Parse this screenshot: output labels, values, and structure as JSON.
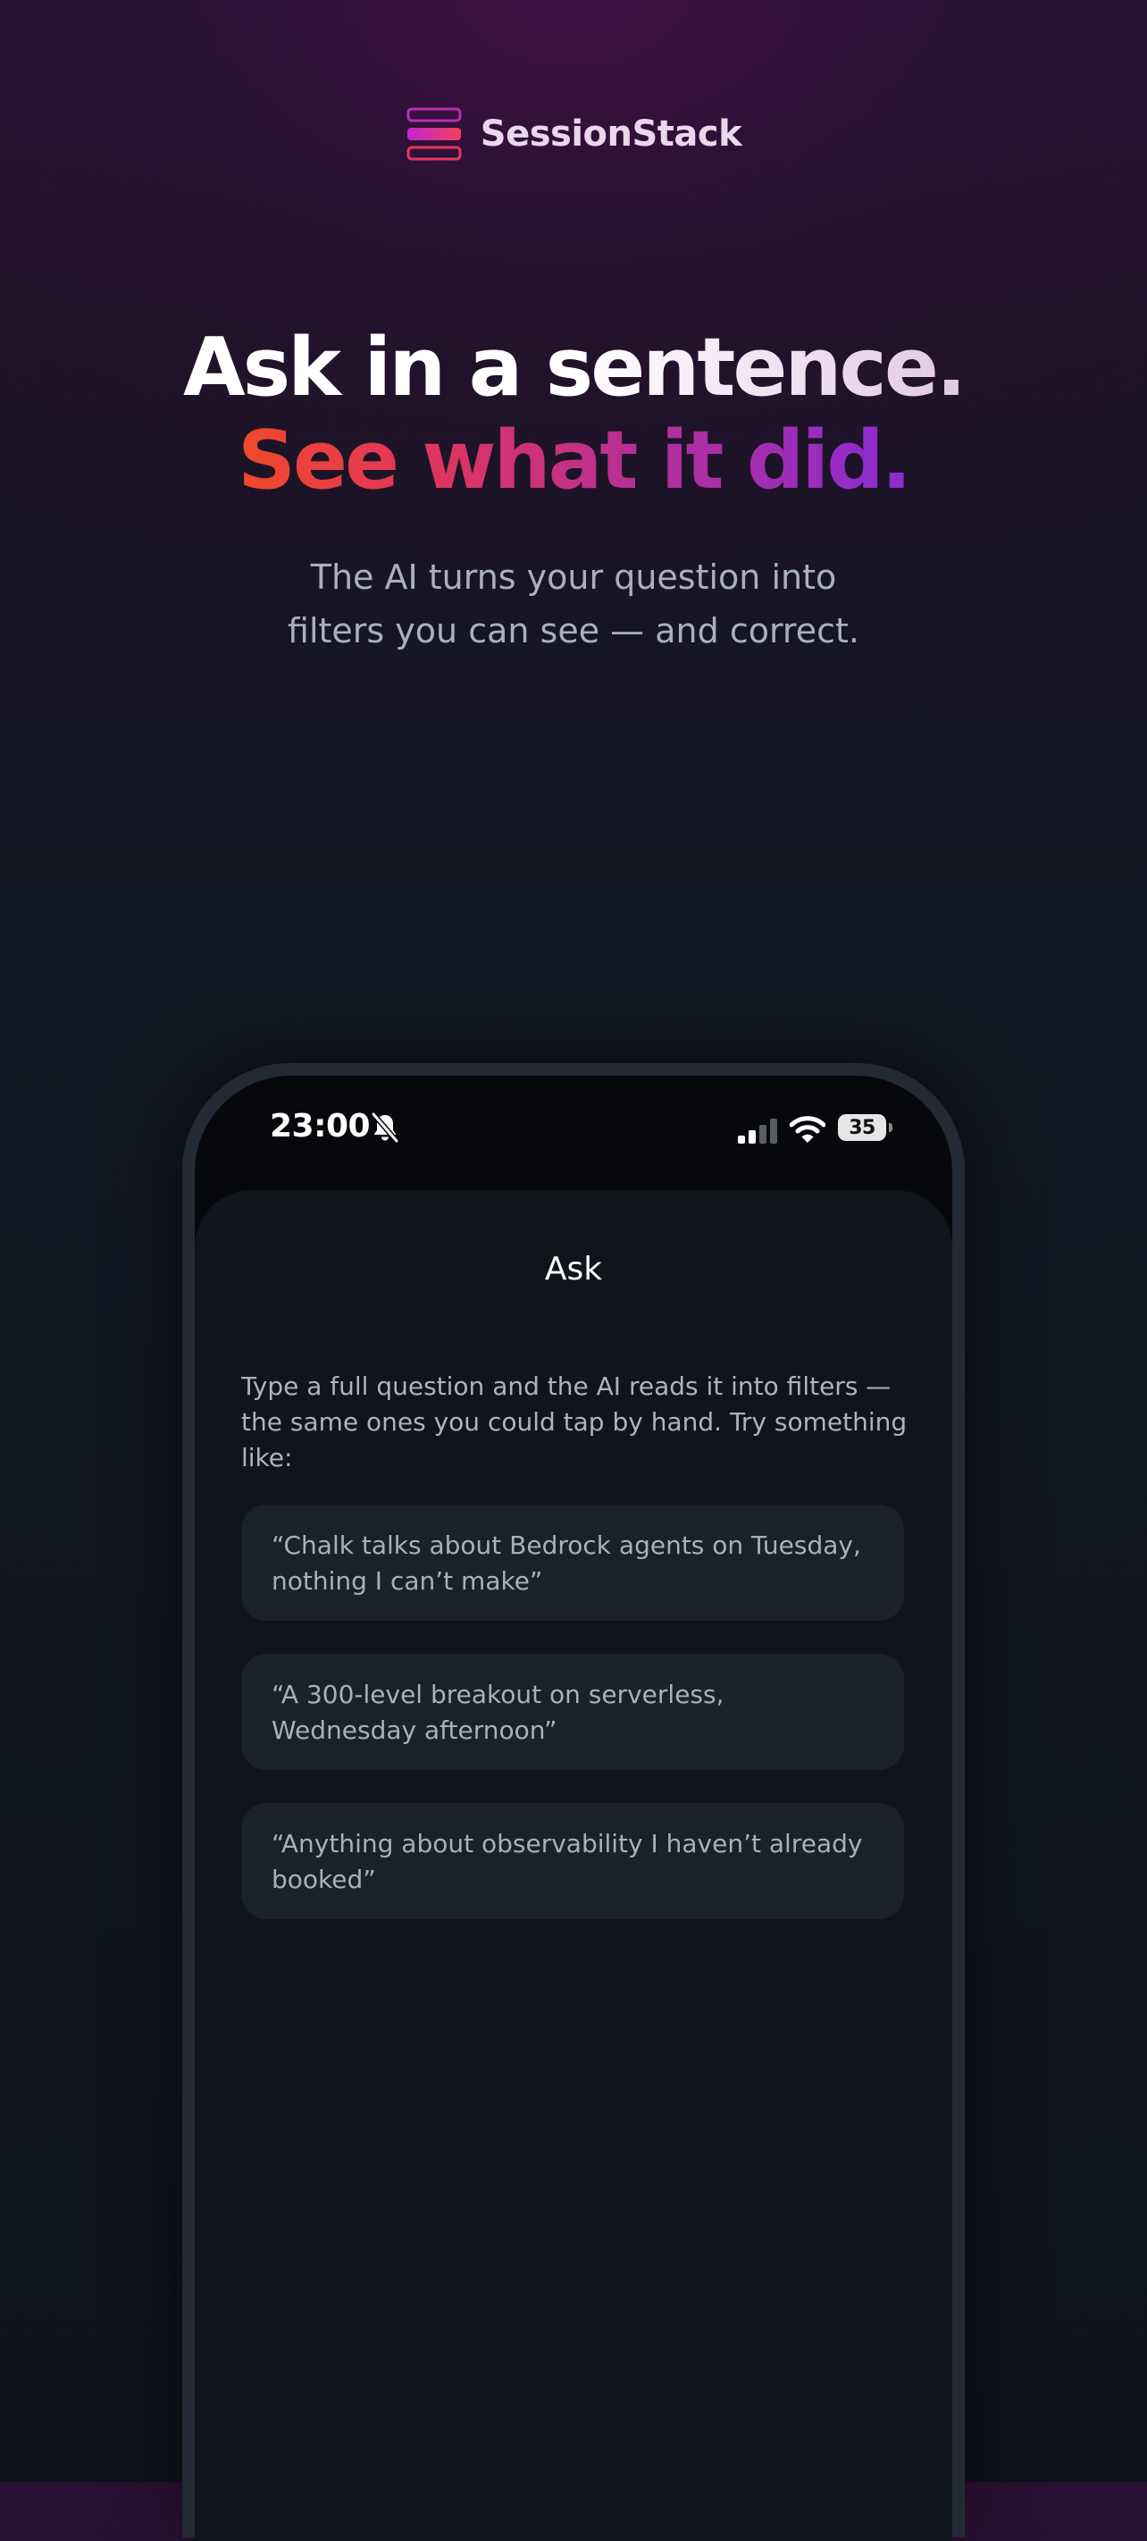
{
  "brand": {
    "name": "SessionStack",
    "logo_icon": "stacked-layers-icon",
    "colors": {
      "accent_pink": "#e0355c",
      "accent_purple": "#8a2bd3",
      "accent_orange": "#f0492a"
    }
  },
  "hero": {
    "headline_line1": "Ask in a sentence.",
    "headline_line2": "See what it did.",
    "subtitle_line1": "The AI turns your question into",
    "subtitle_line2": "filters you can see — and correct."
  },
  "phone": {
    "status_bar": {
      "time": "23:00",
      "mute_icon": "bell-slash-icon",
      "signal_icon": "cellular-signal-icon",
      "wifi_icon": "wifi-icon",
      "battery_level": "35"
    },
    "screen": {
      "title": "Ask",
      "intro": "Type a full question and the AI reads it into filters — the same ones you could tap by hand. Try something like:",
      "examples": [
        {
          "text": "“Chalk talks about Bedrock agents on Tuesday, nothing I can’t make”"
        },
        {
          "text": "“A 300-level breakout on serverless, Wednesday afternoon”"
        },
        {
          "text": "“Anything about observability I haven’t already booked”"
        }
      ]
    }
  }
}
